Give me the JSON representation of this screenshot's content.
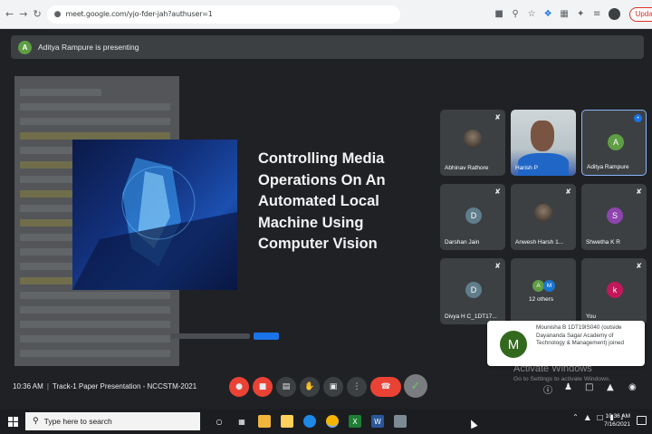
{
  "browser": {
    "url": "meet.google.com/yjo-fder-jah?authuser=1",
    "update_label": "Update",
    "icons": [
      "back-icon",
      "forward-icon",
      "reload-icon",
      "lock-icon",
      "cast-icon",
      "zoom-icon",
      "star-icon",
      "extension-icon",
      "kebab-icon"
    ]
  },
  "banner": {
    "avatar_letter": "A",
    "text": "Aditya Rampure is presenting"
  },
  "slide": {
    "title": "Controlling Media Operations On An Automated Local Machine Using Computer Vision"
  },
  "tiles": [
    {
      "name": "Abhinav Rathore",
      "kind": "photo",
      "muted": true
    },
    {
      "name": "Harish P",
      "kind": "video",
      "muted": false
    },
    {
      "name": "Aditya Rampure",
      "kind": "avatar",
      "letter": "A",
      "color": "#5f9e44",
      "speaking": true
    },
    {
      "name": "Darshan Jain",
      "kind": "avatar",
      "letter": "D",
      "color": "#607d8b",
      "muted": true
    },
    {
      "name": "Anwesh Harsh 1...",
      "kind": "photo",
      "muted": true
    },
    {
      "name": "Shwetha K R",
      "kind": "avatar",
      "letter": "S",
      "color": "#8e44ad",
      "muted": true
    },
    {
      "name": "Divya H C_1DT17...",
      "kind": "avatar",
      "letter": "D",
      "color": "#607d8b",
      "muted": true
    },
    {
      "name": "12 others",
      "kind": "group",
      "letters": [
        "A",
        "M"
      ]
    },
    {
      "name": "You",
      "kind": "avatar",
      "letter": "k",
      "color": "#c2185b",
      "muted": true
    }
  ],
  "notification": {
    "avatar_letter": "M",
    "text": "Mounisha B 1DT19IS040 (outside Dayananda Sagar Academy of Technology & Management) joined"
  },
  "watermark": {
    "title": "Activate Windows",
    "subtitle": "Go to Settings to activate Windows."
  },
  "meeting": {
    "time": "10:36 AM",
    "title": "Track-1 Paper Presentation - NCCSTM-2021"
  },
  "taskbar": {
    "search_placeholder": "Type here to search",
    "clock_time": "10:36 AM",
    "clock_date": "7/16/2021"
  },
  "colors": {
    "meet_bg": "#202124",
    "tile_bg": "#3c4043",
    "danger": "#ea4335",
    "accent": "#1a73e8"
  }
}
